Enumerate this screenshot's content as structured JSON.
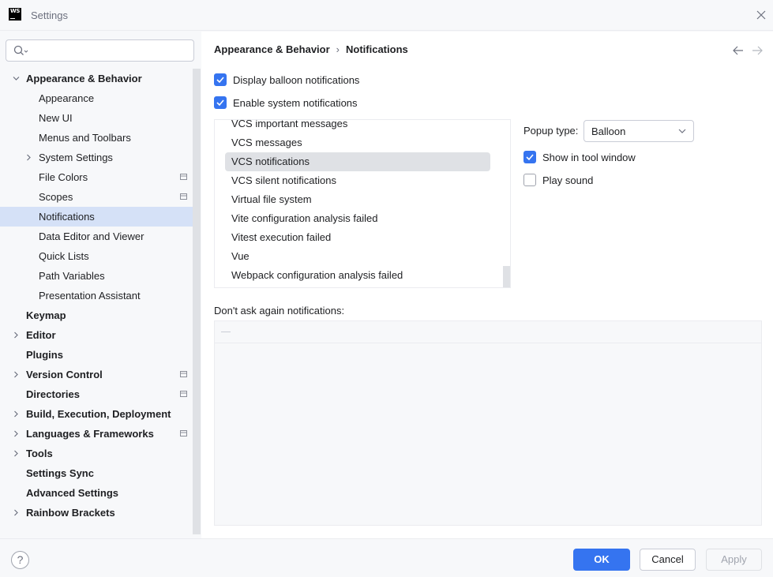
{
  "window": {
    "title": "Settings",
    "logo_text": "WS",
    "close_icon": "close-icon"
  },
  "search": {
    "placeholder": "",
    "value": ""
  },
  "sidebar": {
    "items": [
      {
        "label": "Appearance & Behavior",
        "bold": true,
        "expanded": true,
        "chevron": "chevron-down-icon"
      },
      {
        "label": "Appearance"
      },
      {
        "label": "New UI"
      },
      {
        "label": "Menus and Toolbars"
      },
      {
        "label": "System Settings",
        "chevron": "chevron-right-icon"
      },
      {
        "label": "File Colors",
        "project_icon": true
      },
      {
        "label": "Scopes",
        "project_icon": true
      },
      {
        "label": "Notifications",
        "selected": true
      },
      {
        "label": "Data Editor and Viewer"
      },
      {
        "label": "Quick Lists"
      },
      {
        "label": "Path Variables"
      },
      {
        "label": "Presentation Assistant"
      },
      {
        "label": "Keymap",
        "bold": true
      },
      {
        "label": "Editor",
        "bold": true,
        "chevron": "chevron-right-icon"
      },
      {
        "label": "Plugins",
        "bold": true
      },
      {
        "label": "Version Control",
        "bold": true,
        "chevron": "chevron-right-icon",
        "project_icon": true
      },
      {
        "label": "Directories",
        "bold": true,
        "project_icon": true
      },
      {
        "label": "Build, Execution, Deployment",
        "bold": true,
        "chevron": "chevron-right-icon"
      },
      {
        "label": "Languages & Frameworks",
        "bold": true,
        "chevron": "chevron-right-icon",
        "project_icon": true
      },
      {
        "label": "Tools",
        "bold": true,
        "chevron": "chevron-right-icon"
      },
      {
        "label": "Settings Sync",
        "bold": true
      },
      {
        "label": "Advanced Settings",
        "bold": true
      },
      {
        "label": "Rainbow Brackets",
        "bold": true,
        "chevron": "chevron-right-icon"
      }
    ]
  },
  "breadcrumb": {
    "parent": "Appearance & Behavior",
    "separator": "›",
    "current": "Notifications"
  },
  "options": {
    "display_balloon": {
      "label": "Display balloon notifications",
      "checked": true
    },
    "enable_system": {
      "label": "Enable system notifications",
      "checked": true
    }
  },
  "notification_groups": [
    {
      "label": "VCS important messages"
    },
    {
      "label": "VCS messages"
    },
    {
      "label": "VCS notifications",
      "selected": true
    },
    {
      "label": "VCS silent notifications"
    },
    {
      "label": "Virtual file system"
    },
    {
      "label": "Vite configuration analysis failed"
    },
    {
      "label": "Vitest execution failed"
    },
    {
      "label": "Vue"
    },
    {
      "label": "Webpack configuration analysis failed"
    }
  ],
  "group_settings": {
    "popup_type_label": "Popup type:",
    "popup_type_value": "Balloon",
    "show_in_tool_window": {
      "label": "Show in tool window",
      "checked": true
    },
    "play_sound": {
      "label": "Play sound",
      "checked": false
    }
  },
  "dont_ask": {
    "label": "Don't ask again notifications:"
  },
  "footer": {
    "help": "?",
    "ok": "OK",
    "cancel": "Cancel",
    "apply": "Apply"
  },
  "colors": {
    "accent": "#3574f0",
    "selection": "#d5e1f7",
    "list_selection": "#dfe1e5"
  }
}
